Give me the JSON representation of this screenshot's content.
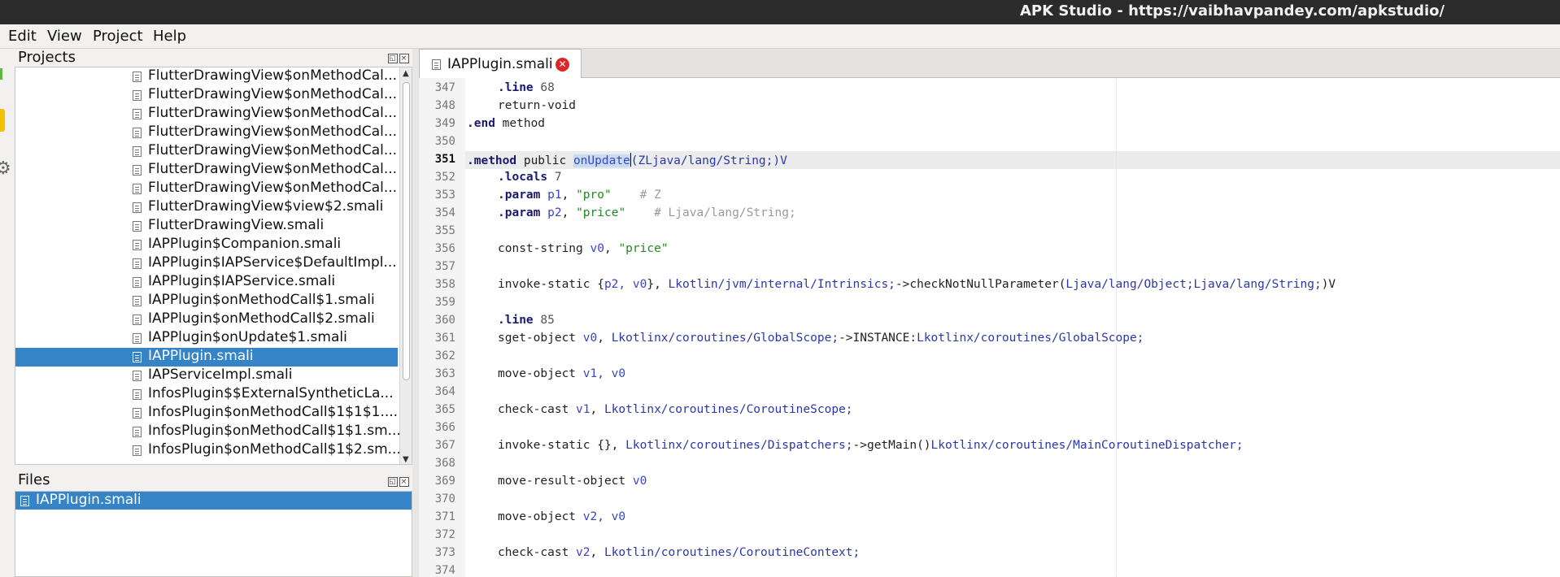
{
  "window": {
    "title": "APK Studio - https://vaibhavpandey.com/apkstudio/"
  },
  "menu": [
    "Edit",
    "View",
    "Project",
    "Help"
  ],
  "projects": {
    "title": "Projects",
    "items": [
      "FlutterDrawingView$onMethodCal...",
      "FlutterDrawingView$onMethodCal...",
      "FlutterDrawingView$onMethodCal...",
      "FlutterDrawingView$onMethodCal...",
      "FlutterDrawingView$onMethodCal...",
      "FlutterDrawingView$onMethodCal...",
      "FlutterDrawingView$onMethodCal...",
      "FlutterDrawingView$view$2.smali",
      "FlutterDrawingView.smali",
      "IAPPlugin$Companion.smali",
      "IAPPlugin$IAPService$DefaultImpl...",
      "IAPPlugin$IAPService.smali",
      "IAPPlugin$onMethodCall$1.smali",
      "IAPPlugin$onMethodCall$2.smali",
      "IAPPlugin$onUpdate$1.smali",
      "IAPPlugin.smali",
      "IAPServiceImpl.smali",
      "InfosPlugin$$ExternalSyntheticLa...",
      "InfosPlugin$onMethodCall$1$1$1....",
      "InfosPlugin$onMethodCall$1$1.sm...",
      "InfosPlugin$onMethodCall$1$2.sm..."
    ],
    "selected_index": 15
  },
  "files": {
    "title": "Files",
    "items": [
      "IAPPlugin.smali"
    ]
  },
  "editor": {
    "tab_label": "IAPPlugin.smali",
    "current_line": "351",
    "line_numbers": [
      "347",
      "348",
      "349",
      "350",
      "351",
      "352",
      "353",
      "354",
      "355",
      "356",
      "357",
      "358",
      "359",
      "360",
      "361",
      "362",
      "363",
      "364",
      "365",
      "366",
      "367",
      "368",
      "369",
      "370",
      "371",
      "372",
      "373",
      "374"
    ],
    "lines": {
      "l347": {
        "kw": ".line",
        "rest": " 68"
      },
      "l348": {
        "text": "return-void"
      },
      "l349": {
        "kw": ".end",
        "rest": " method"
      },
      "l351": {
        "kw": ".method",
        "mid": " public ",
        "sel": "onUpdate",
        "rest": "(ZLjava/lang/String;)V"
      },
      "l352": {
        "kw": ".locals",
        "rest": " 7"
      },
      "l353": {
        "kw": ".param",
        "reg": " p1",
        "comma": ", ",
        "str": "\"pro\"",
        "cm": "    # Z"
      },
      "l354": {
        "kw": ".param",
        "reg": " p2",
        "comma": ", ",
        "str": "\"price\"",
        "cm": "    # Ljava/lang/String;"
      },
      "l356": {
        "op": "const-string ",
        "reg": "v0",
        "comma": ", ",
        "str": "\"price\""
      },
      "l358": {
        "op": "invoke-static {",
        "reg": "p2, v0",
        "mid": "}, ",
        "ty": "Lkotlin/jvm/internal/Intrinsics;",
        "arrow": "->checkNotNullParameter(",
        "ty2": "Ljava/lang/Object;Ljava/lang/String;",
        "rest": ")V"
      },
      "l360": {
        "kw": ".line",
        "rest": " 85"
      },
      "l361": {
        "op": "sget-object ",
        "reg": "v0",
        "comma": ", ",
        "ty": "Lkotlinx/coroutines/GlobalScope;",
        "arrow": "->INSTANCE:",
        "ty2": "Lkotlinx/coroutines/GlobalScope;"
      },
      "l363": {
        "op": "move-object ",
        "reg": "v1, v0"
      },
      "l365": {
        "op": "check-cast ",
        "reg": "v1",
        "comma": ", ",
        "ty": "Lkotlinx/coroutines/CoroutineScope;"
      },
      "l367": {
        "op": "invoke-static {}, ",
        "ty": "Lkotlinx/coroutines/Dispatchers;",
        "arrow": "->getMain()",
        "ty2": "Lkotlinx/coroutines/MainCoroutineDispatcher;"
      },
      "l369": {
        "op": "move-result-object ",
        "reg": "v0"
      },
      "l371": {
        "op": "move-object ",
        "reg": "v2, v0"
      },
      "l373": {
        "op": "check-cast ",
        "reg": "v2",
        "comma": ", ",
        "ty": "Lkotlin/coroutines/CoroutineContext;"
      }
    }
  }
}
